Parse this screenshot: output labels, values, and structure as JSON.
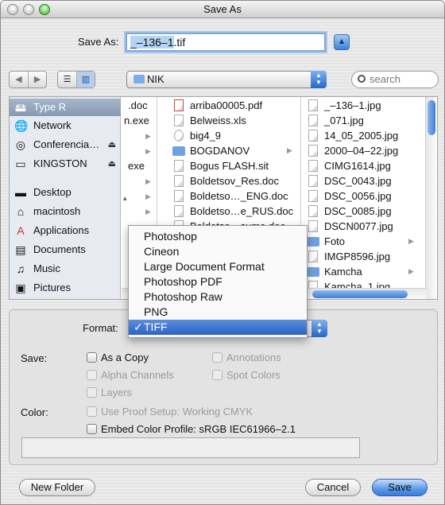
{
  "window": {
    "title": "Save As"
  },
  "save_as": {
    "label": "Save As:",
    "filename_selected": "_–136–1",
    "filename_ext": ".tif"
  },
  "toolbar": {
    "location": "NIK",
    "search_placeholder": "search"
  },
  "sidebar": {
    "devices": [
      {
        "label": "Type R",
        "icon": "hard-disk-icon",
        "selected": true
      },
      {
        "label": "Network",
        "icon": "network-globe-icon"
      },
      {
        "label": "Conferencia…",
        "icon": "cd-disc-icon",
        "eject": true
      },
      {
        "label": "KINGSTON",
        "icon": "usb-drive-icon",
        "eject": true
      }
    ],
    "places": [
      {
        "label": "Desktop",
        "icon": "desktop-icon"
      },
      {
        "label": "macintosh",
        "icon": "home-icon"
      },
      {
        "label": "Applications",
        "icon": "applications-icon"
      },
      {
        "label": "Documents",
        "icon": "documents-icon"
      },
      {
        "label": "Music",
        "icon": "music-icon"
      },
      {
        "label": "Pictures",
        "icon": "pictures-icon"
      }
    ]
  },
  "columns": {
    "col1": [
      ".doc",
      "n.exe",
      "",
      "",
      "exe",
      "",
      "",
      ""
    ],
    "col2": [
      "arriba00005.pdf",
      "Belweiss.xls",
      "big4_9",
      "BOGDANOV",
      "Bogus FLASH.sit",
      "Boldetsov_Res.doc",
      "Boldetso…_ENG.doc",
      "Boldetso…e_RUS.doc",
      "Boldetso…sume.doc"
    ],
    "col3": [
      "_–136–1.jpg",
      "_071.jpg",
      "14_05_2005.jpg",
      "2000–04–22.jpg",
      "CIMG1614.jpg",
      "DSC_0043.jpg",
      "DSC_0056.jpg",
      "DSC_0085.jpg",
      "DSCN0077.jpg",
      "Foto",
      "IMGP8596.jpg",
      "Kamcha",
      "Kamcha_1.jpg"
    ]
  },
  "format_menu": {
    "items": [
      "Photoshop",
      "Cineon",
      "Large Document Format",
      "Photoshop PDF",
      "Photoshop Raw",
      "PNG",
      "TIFF"
    ],
    "selected": "TIFF",
    "check": "✓"
  },
  "options": {
    "format_label": "Format:",
    "save_label": "Save:",
    "color_label": "Color:",
    "as_copy": "As a Copy",
    "annotations": "Annotations",
    "alpha_channels": "Alpha Channels",
    "spot_colors": "Spot Colors",
    "layers": "Layers",
    "use_proof": "Use Proof Setup:  Working CMYK",
    "embed_profile": "Embed Color Profile:  sRGB IEC61966–2.1"
  },
  "buttons": {
    "new_folder": "New Folder",
    "cancel": "Cancel",
    "save": "Save"
  }
}
